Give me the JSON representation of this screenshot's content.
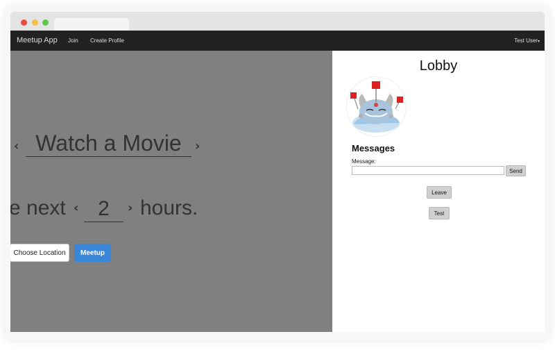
{
  "navbar": {
    "brand": "Meetup App",
    "links": [
      "Join",
      "Create Profile"
    ],
    "user": "Test User"
  },
  "planner": {
    "activity": "Watch a Movie",
    "sentence_start": "e next",
    "hours": "2",
    "sentence_end": "hours.",
    "choose_location_label": "Choose Location",
    "meetup_label": "Meetup"
  },
  "lobby": {
    "title": "Lobby",
    "messages_heading": "Messages",
    "message_label": "Message:",
    "message_value": "",
    "send_label": "Send",
    "leave_label": "Leave",
    "test_label": "Test"
  },
  "colors": {
    "navbar_bg": "#222222",
    "left_panel_bg": "#808080",
    "meetup_button": "#3a87d9"
  }
}
